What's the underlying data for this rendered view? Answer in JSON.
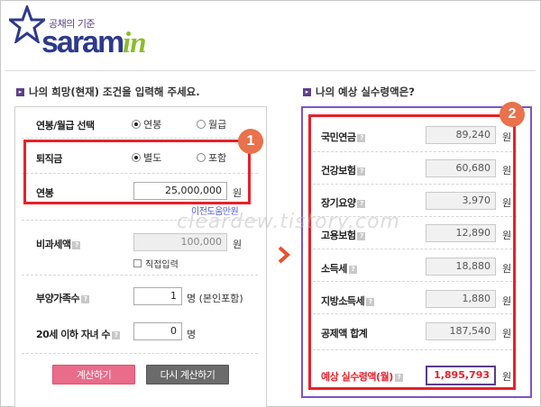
{
  "header": {
    "slogan": "공채의 기준",
    "brand": "saram",
    "brand_in": "in"
  },
  "left": {
    "title": "나의 희망(현재) 조건을 입력해 주세요.",
    "salary_type": {
      "label": "연봉/월급 선택",
      "options": [
        "연봉",
        "월급"
      ],
      "selected": 0
    },
    "severance": {
      "label": "퇴직금",
      "options": [
        "별도",
        "포함"
      ],
      "selected": 0
    },
    "annual_salary": {
      "label": "연봉",
      "value": "25,000,000",
      "unit": "원",
      "link": "이전도움만원"
    },
    "non_taxable": {
      "label": "비과세액",
      "value": "100,000",
      "unit": "원",
      "checkbox": "직접입력"
    },
    "dependents": {
      "label": "부양가족수",
      "value": "1",
      "unit": "명 (본인포함)"
    },
    "children": {
      "label": "20세 이하 자녀 수",
      "value": "0",
      "unit": "명"
    },
    "buttons": {
      "calc": "계산하기",
      "recalc": "다시 계산하기"
    }
  },
  "right": {
    "title": "나의 예상 실수령액은?",
    "rows": [
      {
        "label": "국민연금",
        "value": "89,240",
        "unit": "원"
      },
      {
        "label": "건강보험",
        "value": "60,680",
        "unit": "원"
      },
      {
        "label": "장기요양",
        "value": "3,970",
        "unit": "원"
      },
      {
        "label": "고용보험",
        "value": "12,890",
        "unit": "원"
      },
      {
        "label": "소득세",
        "value": "18,880",
        "unit": "원"
      },
      {
        "label": "지방소득세",
        "value": "1,880",
        "unit": "원"
      },
      {
        "label": "공제액 합계",
        "value": "187,540",
        "unit": "원"
      }
    ],
    "total": {
      "label": "예상 실수령액(월)",
      "value": "1,895,793",
      "unit": "원"
    }
  },
  "annotations": {
    "badge1": "1",
    "badge2": "2"
  },
  "watermark": "cleardew.tistory.com",
  "colors": {
    "accent": "#5b3d8a",
    "annotation_red": "#e8202a",
    "badge": "#e9714b",
    "calc_button": "#ea6b8a"
  }
}
